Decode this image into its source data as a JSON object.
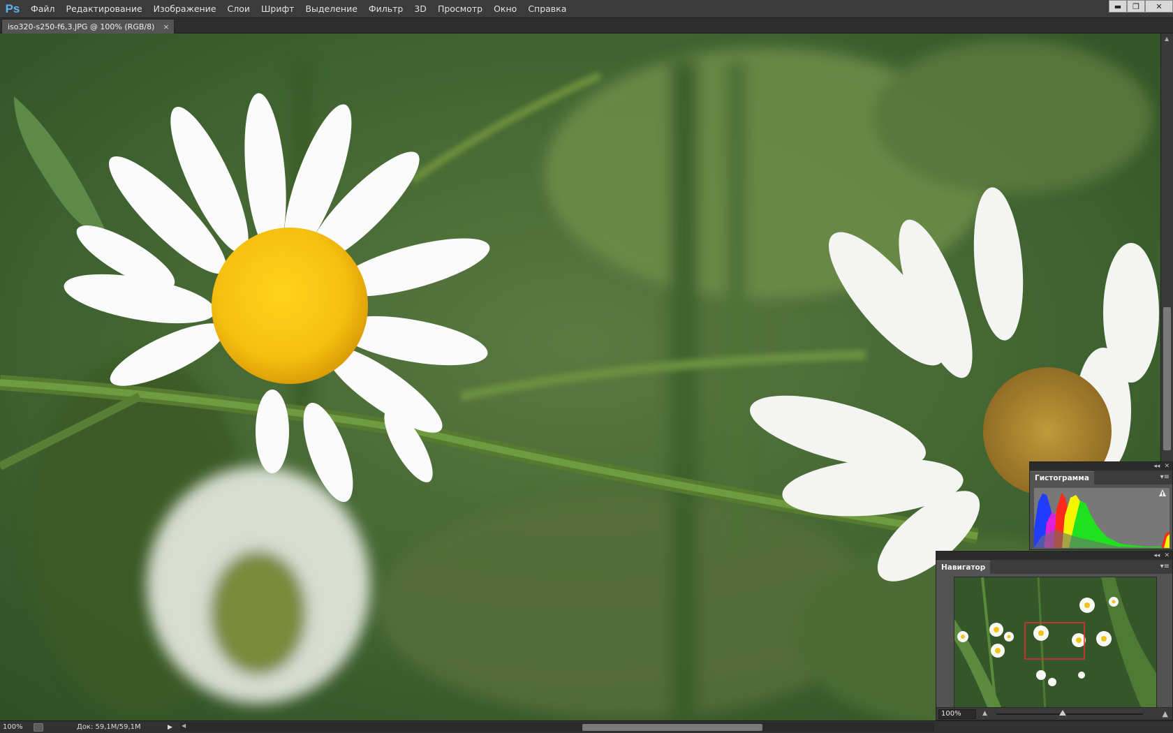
{
  "app": {
    "logo": "Ps",
    "menu": [
      "Файл",
      "Редактирование",
      "Изображение",
      "Слои",
      "Шрифт",
      "Выделение",
      "Фильтр",
      "3D",
      "Просмотр",
      "Окно",
      "Справка"
    ],
    "window_controls": {
      "minimize": "▬",
      "restore": "❐",
      "close": "✕"
    }
  },
  "document": {
    "tab_title": "iso320-s250-f6,3.JPG @ 100% (RGB/8)",
    "tab_close": "×"
  },
  "status": {
    "zoom": "100%",
    "doc_info": "Док: 59,1M/59,1M",
    "arrow": "▶"
  },
  "scrollbar": {
    "up": "▲",
    "down": "▼",
    "left": "◀"
  },
  "histogram_panel": {
    "title": "Гистограмма",
    "collapse": "◂◂",
    "close": "✕",
    "menu": "▾≡",
    "warning_icon": "warning-triangle-icon"
  },
  "navigator_panel": {
    "title": "Навигатор",
    "collapse": "◂◂",
    "close": "✕",
    "menu": "▾≡",
    "zoom": "100%",
    "zoom_slider_fraction": 0.45,
    "zoom_out_icon": "small-mountain-icon",
    "zoom_in_icon": "large-mountain-icon"
  }
}
